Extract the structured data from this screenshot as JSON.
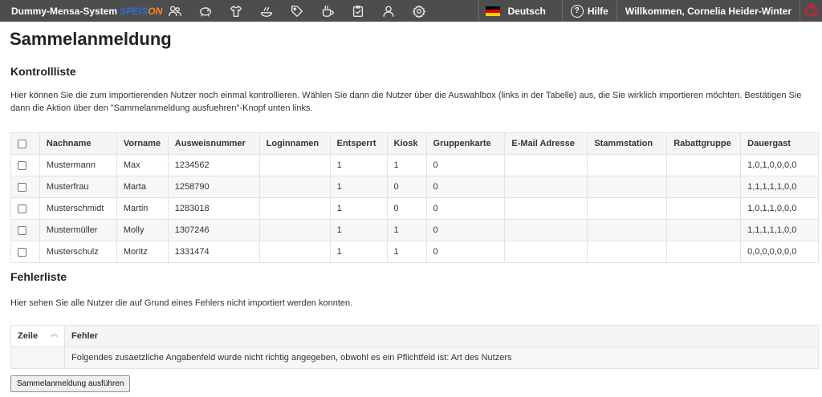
{
  "brand": {
    "name": "Dummy-Mensa-System",
    "logo_part1": "SPEIS",
    "logo_part2": "ON"
  },
  "nav_icons": [
    "users-icon",
    "piggy-bank-icon",
    "shirt-icon",
    "dish-icon",
    "tag-icon",
    "cup-icon",
    "clipboard-icon",
    "user-icon",
    "gear-icon"
  ],
  "header": {
    "language": "Deutsch",
    "help": "Hilfe",
    "welcome": "Willkommen, Cornelia Heider-Winter"
  },
  "page": {
    "title": "Sammelanmeldung",
    "kontroll_title": "Kontrollliste",
    "kontroll_text": "Hier können Sie die zum importierenden Nutzer noch einmal kontrollieren. Wählen Sie dann die Nutzer über die Auswahlbox (links in der Tabelle) aus, die Sie wirklich importieren möchten. Bestätigen Sie dann die Aktion über den \"Sammelanmeldung ausfuehren\"-Knopf unten links.",
    "fehler_title": "Fehlerliste",
    "fehler_text": "Hier sehen Sie alle Nutzer die auf Grund eines Fehlers nicht importiert werden konnten.",
    "execute_button": "Sammelanmeldung ausführen"
  },
  "kontroll_table": {
    "headers": [
      "Nachname",
      "Vorname",
      "Ausweisnummer",
      "Loginnamen",
      "Entsperrt",
      "Kiosk",
      "Gruppenkarte",
      "E-Mail Adresse",
      "Stammstation",
      "Rabattgruppe",
      "Dauergast"
    ],
    "rows": [
      [
        "Mustermann",
        "Max",
        "1234562",
        "",
        "1",
        "1",
        "0",
        "",
        "",
        "",
        "1,0,1,0,0,0,0"
      ],
      [
        "Musterfrau",
        "Marta",
        "1258790",
        "",
        "1",
        "0",
        "0",
        "",
        "",
        "",
        "1,1,1,1,1,0,0"
      ],
      [
        "Musterschmidt",
        "Martin",
        "1283018",
        "",
        "1",
        "0",
        "0",
        "",
        "",
        "",
        "1,0,1,1,0,0,0"
      ],
      [
        "Mustermüller",
        "Molly",
        "1307246",
        "",
        "1",
        "1",
        "0",
        "",
        "",
        "",
        "1,1,1,1,1,0,0"
      ],
      [
        "Musterschulz",
        "Moritz",
        "1331474",
        "",
        "1",
        "1",
        "0",
        "",
        "",
        "",
        "0,0,0,0,0,0,0"
      ]
    ]
  },
  "fehler_table": {
    "headers": [
      "Zeile",
      "Fehler"
    ],
    "rows": [
      [
        "",
        "Folgendes zusaetzliche Angabenfeld wurde nicht richtig angegeben, obwohl es ein Pflichtfeld ist: Art des Nutzers"
      ]
    ]
  },
  "colors": {
    "topbar": "#4d4d4d",
    "logo_blue": "#2f6fd6",
    "logo_orange": "#ff8c1a",
    "power_red": "#e31b23"
  }
}
